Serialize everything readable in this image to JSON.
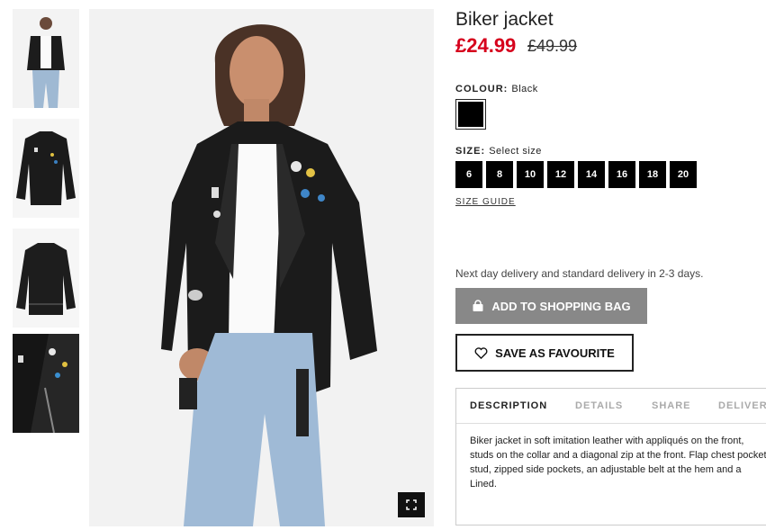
{
  "product": {
    "title": "Biker jacket",
    "price": "£24.99",
    "old_price": "£49.99"
  },
  "colour": {
    "label": "COLOUR:",
    "value": "Black",
    "swatch_color": "#000000"
  },
  "size": {
    "label": "SIZE:",
    "placeholder": "Select size",
    "options": [
      "6",
      "8",
      "10",
      "12",
      "14",
      "16",
      "18",
      "20"
    ],
    "guide_label": "SIZE GUIDE"
  },
  "delivery_text": "Next day delivery and standard delivery in 2-3 days.",
  "buttons": {
    "add_to_bag": "ADD TO SHOPPING BAG",
    "save_favourite": "SAVE AS FAVOURITE"
  },
  "tabs": [
    "DESCRIPTION",
    "DETAILS",
    "SHARE",
    "DELIVERY"
  ],
  "description": "Biker jacket in soft imitation leather with appliqués on the front, studs on the collar and a diagonal zip at the front. Flap chest pocket with press-stud, zipped side pockets, an adjustable belt at the hem and a ... Lined.",
  "description_lines": [
    "Biker jacket in soft imitation leather with appliqués on the front,",
    "studs on the collar and a diagonal zip at the front. Flap chest pocket",
    "stud, zipped side pockets, an adjustable belt at the hem and a",
    "Lined."
  ],
  "icons": {
    "bag": "shopping-bag-icon",
    "heart": "heart-icon",
    "expand": "expand-icon"
  },
  "colors": {
    "price_red": "#d6001c",
    "add_button_bg": "#888888",
    "size_button_bg": "#000000"
  }
}
